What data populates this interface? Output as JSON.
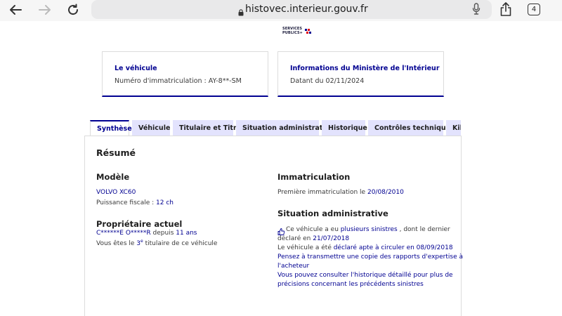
{
  "browser": {
    "url": "histovec.interieur.gouv.fr",
    "tab_count": "4"
  },
  "logo": {
    "line1": "SERVICES",
    "line2": "PUBLICS+"
  },
  "cards": {
    "vehicle": {
      "title": "Le véhicule",
      "text": "Numéro d'immatriculation : AY-8**-SM"
    },
    "ministry": {
      "title": "Informations du Ministère de l'Intérieur",
      "text": "Datant du 02/11/2024"
    }
  },
  "tabs": [
    {
      "label": "Synthèse",
      "active": true
    },
    {
      "label": "Véhicule",
      "active": false
    },
    {
      "label": "Titulaire et Titre",
      "active": false
    },
    {
      "label": "Situation administrative",
      "active": false
    },
    {
      "label": "Historique",
      "active": false
    },
    {
      "label": "Contrôles techniques",
      "active": false
    },
    {
      "label": "Kil",
      "active": false
    }
  ],
  "resume": {
    "title": "Résumé",
    "modele": {
      "heading": "Modèle",
      "model": "VOLVO XC60",
      "puissance_label": "Puissance fiscale : ",
      "puissance_value": "12 ch"
    },
    "proprietaire": {
      "heading": "Propriétaire actuel",
      "name": "C******E O*****R",
      "depuis_label": " depuis ",
      "depuis_value": "11 ans",
      "rank_prefix": "Vous êtes le ",
      "rank_value": "3",
      "rank_suffix_sup": "e",
      "rank_suffix": " titulaire de ce véhicule"
    },
    "immatriculation": {
      "heading": "Immatriculation",
      "label": "Première immatriculation le ",
      "date": "20/08/2010"
    },
    "situation": {
      "heading": "Situation administrative",
      "sinistre_prefix": "Ce véhicule a eu ",
      "sinistre_link": "plusieurs sinistres",
      "sinistre_suffix": " , dont le dernier",
      "declare_label": "déclaré en ",
      "declare_date": "21/07/2018",
      "apte_prefix": "Le véhicule a été ",
      "apte_link": "déclaré apte à circuler en 08/09/2018",
      "transmettre_line1": "Pensez à transmettre une copie des rapports d'expertise à",
      "transmettre_line2": "l'acheteur",
      "historique_line1": "Vous pouvez consulter l'historique détaillé pour plus de",
      "historique_line2": "précisions concernant les précédents sinistres"
    }
  }
}
